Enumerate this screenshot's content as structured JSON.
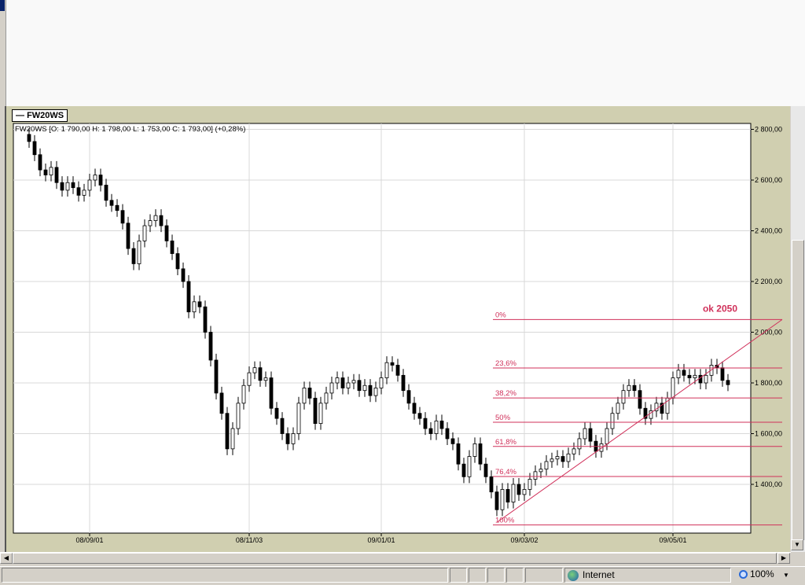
{
  "chart_tab": "FW20WS",
  "status_bar": {
    "zone": "Internet",
    "zoom": "100%"
  },
  "colors": {
    "fib": "#d0305a",
    "bull": "#ffffff",
    "bear": "#000000",
    "grid": "#d8d8d8",
    "panel": "#d0cfb0"
  },
  "chart_data": {
    "type": "candlestick",
    "title": "FW20WS [O: 1 790,00  H: 1 798,00  L: 1 753,00  C: 1 793,00] (+0,28%)",
    "ylim": [
      1220,
      2850
    ],
    "y_ticks": [
      2800,
      2600,
      2400,
      2200,
      2000,
      1800,
      1600,
      1400
    ],
    "y_tick_labels": [
      "2 800,00",
      "2 600,00",
      "2 400,00",
      "2 200,00",
      "2 000,00",
      "1 800,00",
      "1 600,00",
      "1 400,00"
    ],
    "x_ticks": [
      {
        "index": 11,
        "label": "08/09/01"
      },
      {
        "index": 40,
        "label": "08/11/03"
      },
      {
        "index": 64,
        "label": "09/01/01"
      },
      {
        "index": 90,
        "label": "09/03/02"
      },
      {
        "index": 117,
        "label": "09/05/01"
      }
    ],
    "first_open": 2780,
    "wick": 25,
    "close": [
      2752,
      2700,
      2640,
      2620,
      2650,
      2590,
      2560,
      2590,
      2570,
      2540,
      2560,
      2600,
      2620,
      2580,
      2520,
      2500,
      2480,
      2430,
      2330,
      2270,
      2360,
      2420,
      2440,
      2460,
      2420,
      2360,
      2310,
      2250,
      2200,
      2080,
      2120,
      2100,
      2000,
      1890,
      1760,
      1680,
      1540,
      1620,
      1720,
      1790,
      1840,
      1860,
      1810,
      1820,
      1700,
      1660,
      1600,
      1560,
      1600,
      1720,
      1780,
      1740,
      1640,
      1720,
      1760,
      1800,
      1820,
      1780,
      1800,
      1810,
      1770,
      1790,
      1750,
      1780,
      1820,
      1880,
      1870,
      1830,
      1770,
      1720,
      1680,
      1660,
      1620,
      1600,
      1650,
      1620,
      1580,
      1560,
      1480,
      1430,
      1510,
      1560,
      1480,
      1430,
      1370,
      1300,
      1380,
      1330,
      1400,
      1360,
      1380,
      1420,
      1450,
      1460,
      1490,
      1500,
      1510,
      1490,
      1520,
      1540,
      1580,
      1620,
      1570,
      1530,
      1560,
      1620,
      1680,
      1720,
      1770,
      1790,
      1770,
      1700,
      1660,
      1690,
      1720,
      1680,
      1740,
      1820,
      1850,
      1830,
      1820,
      1830,
      1800,
      1830,
      1870,
      1860,
      1810,
      1793
    ],
    "fibonacci": {
      "high": 2050,
      "low": 1240,
      "start_index": 85,
      "levels": [
        {
          "ratio": 0,
          "label": "0%"
        },
        {
          "ratio": 0.236,
          "label": "23,6%"
        },
        {
          "ratio": 0.382,
          "label": "38,2%"
        },
        {
          "ratio": 0.5,
          "label": "50%"
        },
        {
          "ratio": 0.618,
          "label": "61,8%"
        },
        {
          "ratio": 0.764,
          "label": "76,4%"
        },
        {
          "ratio": 1,
          "label": "100%"
        }
      ]
    },
    "annotation": "ok 2050",
    "trendline": {
      "from_index": 85,
      "from_value": 1250,
      "to_value": 2050
    }
  }
}
